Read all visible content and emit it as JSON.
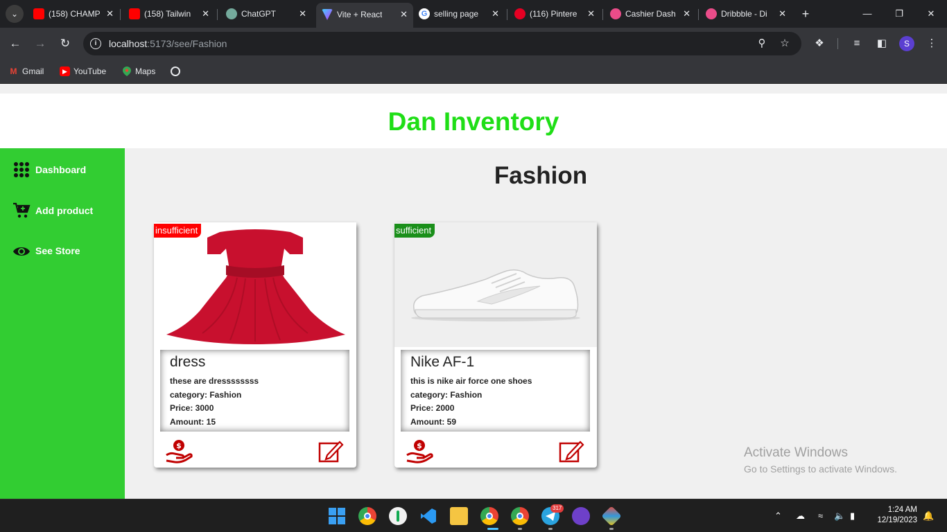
{
  "browser": {
    "tabs": [
      {
        "title": "(158) CHAMP",
        "favicon": "youtube-icon",
        "active": false
      },
      {
        "title": "(158) Tailwin",
        "favicon": "youtube-icon",
        "active": false
      },
      {
        "title": "ChatGPT",
        "favicon": "chatgpt-icon",
        "active": false
      },
      {
        "title": "Vite + React",
        "favicon": "vite-icon",
        "active": true
      },
      {
        "title": "selling page",
        "favicon": "google-icon",
        "active": false
      },
      {
        "title": "(116) Pintere",
        "favicon": "pinterest-icon",
        "active": false
      },
      {
        "title": "Cashier Dash",
        "favicon": "dribbble-icon",
        "active": false
      },
      {
        "title": "Dribbble - Di",
        "favicon": "dribbble-icon",
        "active": false
      }
    ],
    "url_host": "localhost",
    "url_path": ":5173/see/Fashion",
    "profile_initial": "S",
    "bookmarks": [
      {
        "label": "Gmail",
        "icon": "gmail-icon"
      },
      {
        "label": "YouTube",
        "icon": "youtube-icon"
      },
      {
        "label": "Maps",
        "icon": "maps-icon"
      }
    ]
  },
  "app": {
    "brand": "Dan Inventory",
    "brand_color": "#1fde16",
    "sidebar_color": "#32cd32",
    "sidebar": [
      {
        "label": "Dashboard",
        "icon": "grid-dots-icon"
      },
      {
        "label": "Add product",
        "icon": "cart-add-icon"
      },
      {
        "label": "See Store",
        "icon": "eye-icon"
      }
    ],
    "category_title": "Fashion",
    "products": [
      {
        "status": "insufficient",
        "status_color": "#ff0000",
        "name": "dress",
        "description": "these are dressssssss",
        "category": "category: Fashion",
        "price": "Price: 3000",
        "amount": "Amount: 15",
        "image": "red-dress-image"
      },
      {
        "status": "sufficient",
        "status_color": "#1a8f1a",
        "name": "Nike AF-1",
        "description": "this is nike air force one shoes",
        "category": "category: Fashion",
        "price": "Price: 2000",
        "amount": "Amount: 59",
        "image": "white-sneaker-image"
      }
    ]
  },
  "watermark": {
    "line1": "Activate Windows",
    "line2": "Go to Settings to activate Windows."
  },
  "taskbar": {
    "time": "1:24 AM",
    "date": "12/19/2023",
    "telegram_badge": "317"
  }
}
